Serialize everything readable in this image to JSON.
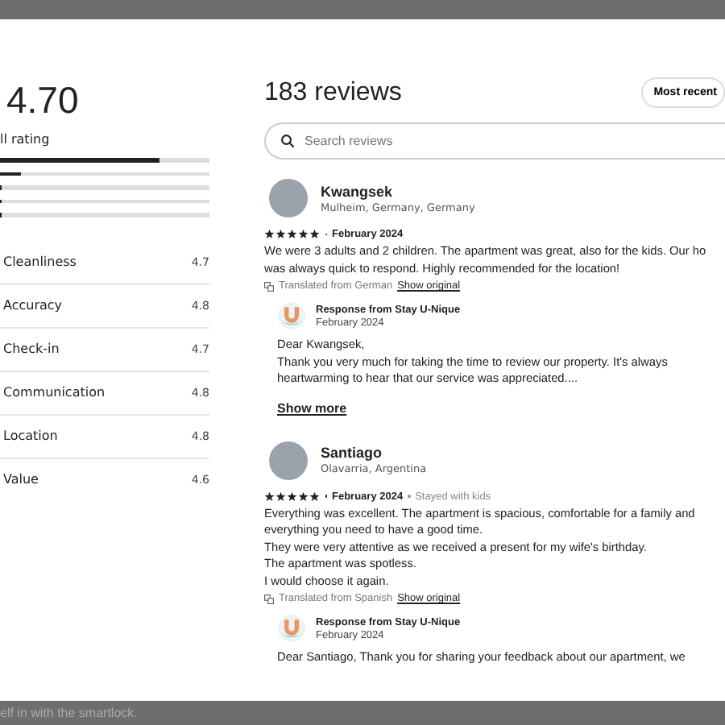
{
  "overall": {
    "score": "4.70",
    "label": "ll rating",
    "distribution": [
      {
        "level": 0.76
      },
      {
        "level": 0.1
      },
      {
        "level": 0
      },
      {
        "level": 0
      },
      {
        "level": 0
      }
    ]
  },
  "categories": [
    {
      "name": "Cleanliness",
      "score": "4.7"
    },
    {
      "name": "Accuracy",
      "score": "4.8"
    },
    {
      "name": "Check-in",
      "score": "4.7"
    },
    {
      "name": "Communication",
      "score": "4.8"
    },
    {
      "name": "Location",
      "score": "4.8"
    },
    {
      "name": "Value",
      "score": "4.6"
    }
  ],
  "reviews_header": {
    "title": "183 reviews",
    "sort_button": "Most recent"
  },
  "search": {
    "placeholder": "Search reviews"
  },
  "reviews": [
    {
      "name": "Kwangsek",
      "location": "Mulheim, Germany, Germany",
      "stars": 5,
      "date": "February 2024",
      "body": [
        "We were 3 adults and 2 children. The apartment was great, also for the kids. Our ho",
        "was always quick to respond. Highly recommended for the location!"
      ],
      "translation": "Translated from German",
      "show_original": "Show original",
      "response": {
        "title": "Response from Stay U-Nique",
        "date": "February 2024",
        "body": [
          "Dear Kwangsek,",
          "Thank you very much for taking the time to review our property. It's always",
          "heartwarming to hear that our service was appreciated...."
        ],
        "show_more": "Show more"
      }
    },
    {
      "name": "Santiago",
      "location": "Olavarria, Argentina",
      "stars": 5,
      "date": "February 2024",
      "stay_note": "Stayed with kids",
      "body": [
        "Everything was excellent. The apartment is spacious, comfortable for a family and",
        "everything you need to have a good time.",
        "They were very attentive as we received a present for my wife's birthday.",
        "The apartment was spotless.",
        "I would choose it again."
      ],
      "translation": "Translated from Spanish",
      "show_original": "Show original",
      "response": {
        "title": "Response from Stay U-Nique",
        "date": "February 2024",
        "body": [
          "Dear Santiago, Thank you for sharing your feedback about our apartment, we"
        ]
      }
    }
  ],
  "footer_text": "elf in with the smartlock."
}
